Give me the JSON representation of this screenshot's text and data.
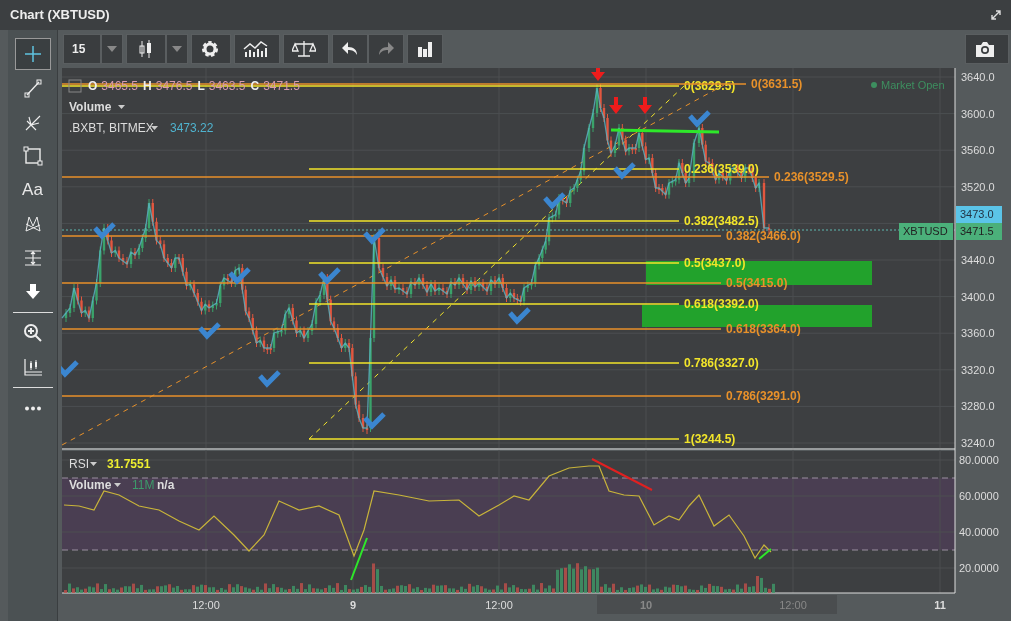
{
  "window": {
    "title": "Chart (XBTUSD)"
  },
  "tool_groups": [
    [
      {
        "kind": "crosshair",
        "selected": true
      },
      {
        "kind": "line",
        "selected": false
      },
      {
        "kind": "pitchfork",
        "selected": false
      },
      {
        "kind": "rectangle",
        "selected": false
      },
      {
        "kind": "text",
        "label": "Aa",
        "selected": false
      },
      {
        "kind": "pattern",
        "selected": false
      },
      {
        "kind": "measure",
        "selected": false
      },
      {
        "kind": "arrow",
        "selected": false
      }
    ],
    [
      {
        "kind": "zoom",
        "selected": false
      },
      {
        "kind": "scale",
        "selected": false
      }
    ],
    [
      {
        "kind": "more",
        "selected": false
      }
    ]
  ],
  "toolbar": {
    "interval": "15"
  },
  "legend": {
    "ohlc": [
      {
        "key": "O",
        "value": "3465.5"
      },
      {
        "key": "H",
        "value": "3476.5"
      },
      {
        "key": "L",
        "value": "3463.5"
      },
      {
        "key": "C",
        "value": "3471.5"
      }
    ],
    "volume_label": "Volume",
    "index_label": ".BXBT, BITMEX",
    "index_value": "3473.22"
  },
  "market_status": "Market Open",
  "fib_sets": [
    {
      "color": "#f2e52a",
      "levels": [
        "0(3629.5)",
        "0.236(3539.0)",
        "0.382(3482.5)",
        "0.5(3437.0)",
        "0.618(3392.0)",
        "0.786(3327.0)",
        "1(3244.5)"
      ]
    },
    {
      "color": "#e8912a",
      "levels": [
        "0(3631.5)",
        "0.236(3529.5)",
        "0.382(3466.0)",
        "0.5(3415.0)",
        "0.618(3364.0)",
        "0.786(3291.0)"
      ]
    }
  ],
  "price_axis": [
    "3640.0",
    "3600.0",
    "3560.0",
    "3520.0",
    "3440.0",
    "3400.0",
    "3360.0",
    "3320.0",
    "3280.0",
    "3240.0"
  ],
  "price_tags": {
    "index_value": "3473.0",
    "symbol": "XBTUSD",
    "last_value": "3471.5"
  },
  "rsi": {
    "label": "RSI",
    "value": "31.7551",
    "volume_label": "Volume",
    "volume_value": "11M",
    "volume_extra": "n/a",
    "axis": [
      "80.0000",
      "60.0000",
      "40.0000",
      "20.0000"
    ]
  },
  "time_axis": [
    "12:00",
    "9",
    "12:00",
    "10",
    "12:00",
    "11"
  ]
}
